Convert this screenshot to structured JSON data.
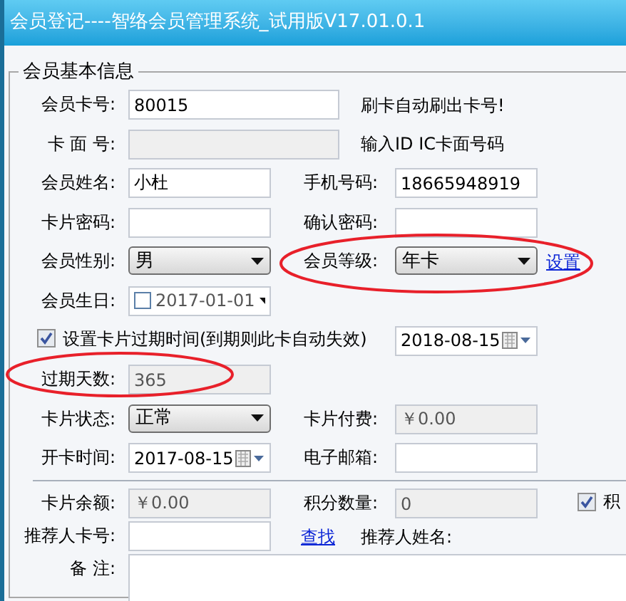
{
  "window": {
    "title": "会员登记----智络会员管理系统_试用版V17.01.0.1"
  },
  "group": {
    "legend": "会员基本信息"
  },
  "sections": [
    {
      "rows": [
        {
          "items": [
            {
              "kind": "label",
              "text": "会员卡号:"
            },
            {
              "kind": "wide_input",
              "value": "80015",
              "disabled": false
            },
            {
              "kind": "hint",
              "text": "刷卡自动刷出卡号!"
            }
          ]
        },
        {
          "items": [
            {
              "kind": "label",
              "text": "卡 面 号:"
            },
            {
              "kind": "wide_input",
              "disabled": true
            },
            {
              "kind": "hint",
              "text": "输入ID IC卡面号码"
            }
          ]
        },
        {
          "items": [
            {
              "kind": "label",
              "text": "会员姓名:"
            },
            {
              "kind": "input",
              "value": "小杜",
              "disabled": false
            },
            {
              "kind": "label",
              "text": "手机号码:"
            },
            {
              "kind": "input",
              "value": "18665948919",
              "disabled": false
            }
          ]
        },
        {
          "items": [
            {
              "kind": "label",
              "text": "卡片密码:"
            },
            {
              "kind": "input",
              "disabled": false
            },
            {
              "kind": "label",
              "text": "确认密码:"
            },
            {
              "kind": "input",
              "disabled": false
            }
          ]
        },
        {
          "items": [
            {
              "kind": "label",
              "text": "会员性别:"
            },
            {
              "kind": "select",
              "value": "男"
            },
            {
              "kind": "label",
              "text": "会员等级:"
            },
            {
              "kind": "select",
              "value": "年卡"
            },
            {
              "kind": "link",
              "text": "设置"
            }
          ]
        },
        {
          "items": [
            {
              "kind": "label",
              "text": "会员生日:"
            },
            {
              "kind": "date_box",
              "value": "2017-01-01",
              "checked": false
            }
          ]
        },
        {
          "items": [
            {
              "kind": "option",
              "text": "设置卡片过期时间(到期则此卡自动失效)",
              "checked": true
            },
            {
              "kind": "date",
              "value": "2018-08-15"
            }
          ]
        },
        {
          "items": [
            {
              "kind": "label",
              "text": "过期天数:"
            },
            {
              "kind": "input",
              "value": "365",
              "disabled": true
            }
          ]
        },
        {
          "items": [
            {
              "kind": "label",
              "text": "卡片状态:"
            },
            {
              "kind": "select",
              "value": "正常"
            },
            {
              "kind": "label",
              "text": "卡片付费:"
            },
            {
              "kind": "input",
              "value": "￥0.00",
              "disabled": true
            }
          ]
        },
        {
          "items": [
            {
              "kind": "label",
              "text": "开卡时间:"
            },
            {
              "kind": "date",
              "value": "2017-08-15"
            },
            {
              "kind": "label",
              "text": "电子邮箱:"
            },
            {
              "kind": "input",
              "disabled": false
            }
          ]
        }
      ]
    },
    {
      "rows": [
        {
          "items": [
            {
              "kind": "label",
              "text": "卡片余额:"
            },
            {
              "kind": "input",
              "value": "￥0.00",
              "disabled": true
            },
            {
              "kind": "label",
              "text": "积分数量:"
            },
            {
              "kind": "input",
              "value": "0",
              "disabled": true
            },
            {
              "kind": "flag",
              "text": "积",
              "checked": true
            }
          ]
        },
        {
          "items": [
            {
              "kind": "label",
              "text": "推荐人卡号:"
            },
            {
              "kind": "input",
              "disabled": false
            },
            {
              "kind": "link",
              "text": "查找"
            },
            {
              "kind": "caption",
              "text": "推荐人姓名:"
            }
          ]
        },
        {
          "items": [
            {
              "kind": "label",
              "text": "备 注:"
            },
            {
              "kind": "textarea"
            }
          ]
        }
      ]
    }
  ]
}
